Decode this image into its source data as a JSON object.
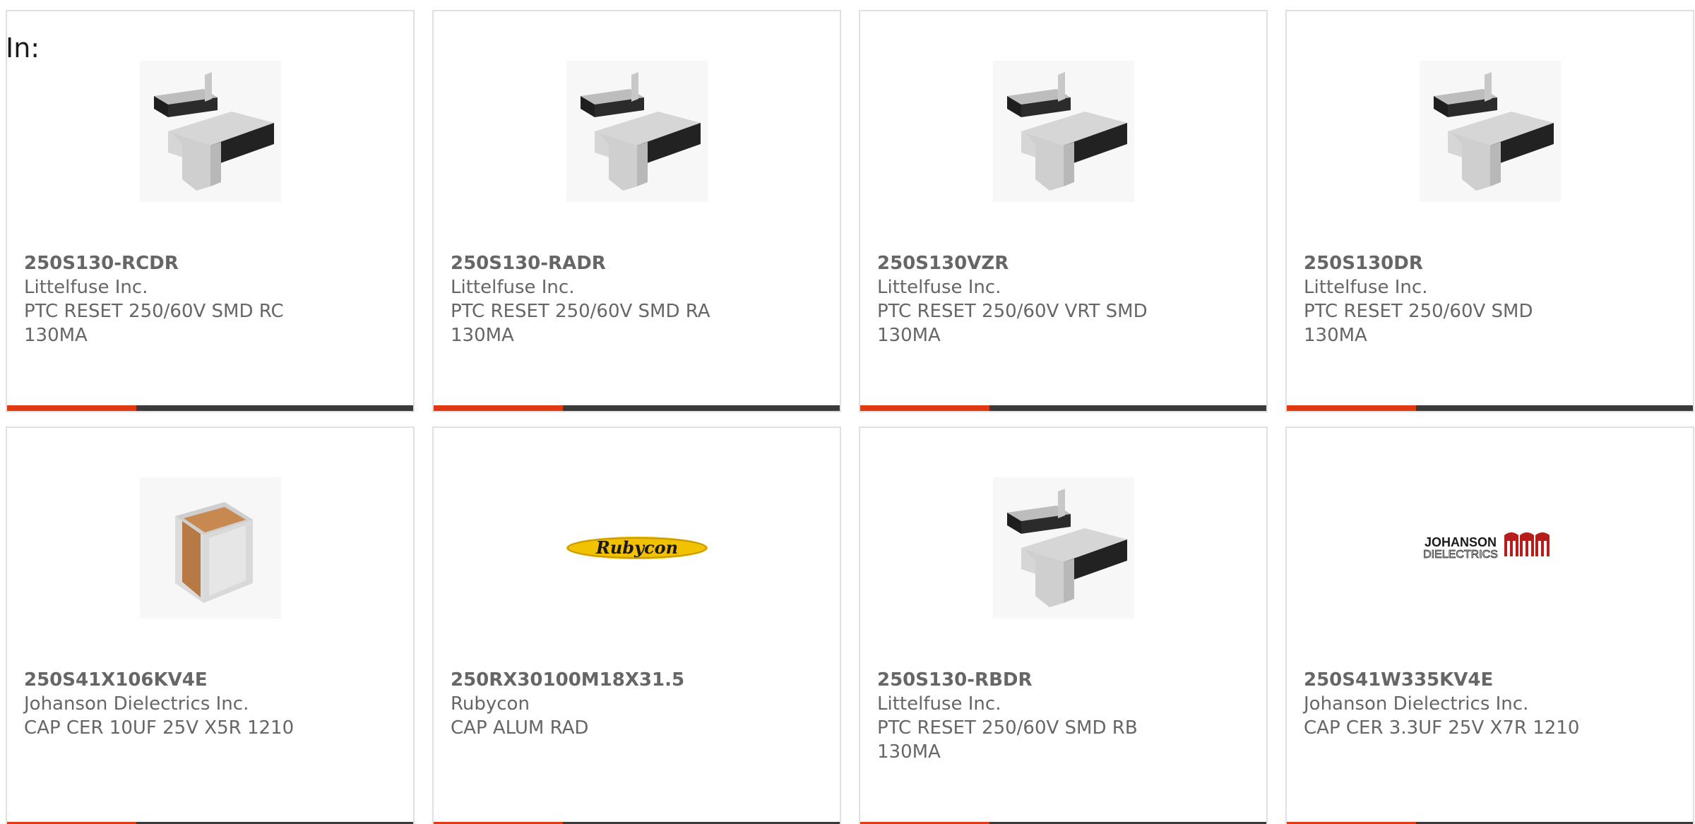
{
  "header": {
    "in_label": "In:"
  },
  "colors": {
    "accent": "#e03a12",
    "bar": "#3a3a3a",
    "text": "#666666",
    "border": "#e0e0e0"
  },
  "products": [
    {
      "part_number": "250S130-RCDR",
      "manufacturer": "Littelfuse Inc.",
      "description": "PTC RESET 250/60V SMD RC 130MA",
      "image": "ptc-fuse-image"
    },
    {
      "part_number": "250S130-RADR",
      "manufacturer": "Littelfuse Inc.",
      "description": "PTC RESET 250/60V SMD RA 130MA",
      "image": "ptc-fuse-image"
    },
    {
      "part_number": "250S130VZR",
      "manufacturer": "Littelfuse Inc.",
      "description": "PTC RESET 250/60V VRT SMD 130MA",
      "image": "ptc-fuse-image"
    },
    {
      "part_number": "250S130DR",
      "manufacturer": "Littelfuse Inc.",
      "description": "PTC RESET 250/60V SMD 130MA",
      "image": "ptc-fuse-image"
    },
    {
      "part_number": "250S41X106KV4E",
      "manufacturer": "Johanson Dielectrics Inc.",
      "description": "CAP CER 10UF 25V X5R 1210",
      "image": "ceramic-capacitor-image"
    },
    {
      "part_number": "250RX30100M18X31.5",
      "manufacturer": "Rubycon",
      "description": "CAP ALUM RAD",
      "image": "rubycon-logo",
      "logo_text": "Rubycon"
    },
    {
      "part_number": "250S130-RBDR",
      "manufacturer": "Littelfuse Inc.",
      "description": "PTC RESET 250/60V SMD RB 130MA",
      "image": "ptc-fuse-image"
    },
    {
      "part_number": "250S41W335KV4E",
      "manufacturer": "Johanson Dielectrics Inc.",
      "description": "CAP CER 3.3UF 25V X7R 1210",
      "image": "johanson-dielectrics-logo",
      "logo_text": [
        "JOHANSON",
        "DIELECTRICS"
      ]
    }
  ]
}
